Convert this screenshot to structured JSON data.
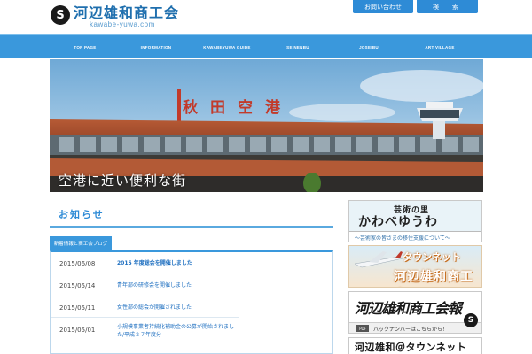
{
  "header": {
    "logo_title": "河辺雄和商工会",
    "logo_sub": "kawabe-yuwa.com",
    "logo_mark": "S",
    "contact_label": "お問い合わせ",
    "search_label": "検　索"
  },
  "nav": {
    "items": [
      {
        "label": "TOP PAGE"
      },
      {
        "label": "INFORMATION"
      },
      {
        "label": "KAWABEYUWA GUIDE"
      },
      {
        "label": "SEINENBU"
      },
      {
        "label": "JOSEIBU"
      },
      {
        "label": "ART VILLAGE"
      }
    ]
  },
  "hero": {
    "sign": [
      "秋",
      "田",
      "空",
      "港"
    ],
    "caption": "空港に近い便利な街"
  },
  "main": {
    "section_title": "お知らせ",
    "news_tab": "新着情報と商工会ブログ",
    "news": [
      {
        "date": "2015/06/08",
        "title": "2015 年度総会を開催しました"
      },
      {
        "date": "2015/05/14",
        "title": "青年部の研修会を開催しました"
      },
      {
        "date": "2015/05/11",
        "title": "女性部の総会が開催されました"
      },
      {
        "date": "2015/05/01",
        "title": "小規模事業者持続化補助金の公募が開始されました/平成２７年度分"
      }
    ]
  },
  "sidebar": {
    "banner1": {
      "small": "芸術の里",
      "big": "かわべゆうわ",
      "sub": "〜芸術家の皆さまの移住支援について〜"
    },
    "banner2": {
      "line1": "タウンネット",
      "line2": "河辺雄和商工会"
    },
    "banner3": {
      "title": "河辺雄和商工会報",
      "seal": "S",
      "pdf": "PDF",
      "sub": "バックナンバーはこちらから！"
    },
    "banner4": {
      "title": "河辺雄和＠タウンネット"
    }
  },
  "colors": {
    "accent": "#3a98dc",
    "brand": "#1f6fae",
    "link": "#1e6fc0"
  }
}
